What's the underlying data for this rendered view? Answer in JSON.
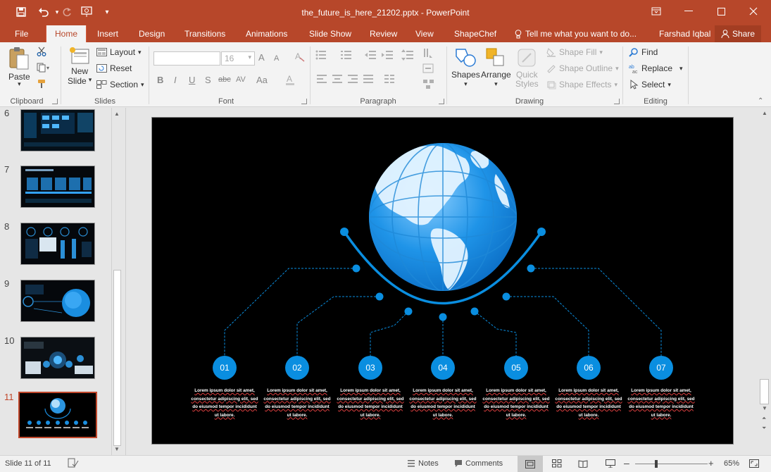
{
  "app": {
    "doc_title": "the_future_is_here_21202.pptx - PowerPoint",
    "user": "Farshad Iqbal",
    "share": "Share",
    "tell_me": "Tell me what you want to do..."
  },
  "tabs": [
    "File",
    "Home",
    "Insert",
    "Design",
    "Transitions",
    "Animations",
    "Slide Show",
    "Review",
    "View",
    "ShapeChef"
  ],
  "ribbon": {
    "clipboard": {
      "label": "Clipboard",
      "paste": "Paste"
    },
    "slides": {
      "label": "Slides",
      "new_slide_1": "New",
      "new_slide_2": "Slide",
      "layout": "Layout",
      "reset": "Reset",
      "section": "Section"
    },
    "font": {
      "label": "Font",
      "size": "16",
      "bold": "B",
      "italic": "I",
      "underline": "U",
      "shadow": "S",
      "strike": "abc",
      "spacing": "AV",
      "case": "Aa",
      "grow": "A",
      "shrink": "A"
    },
    "paragraph": {
      "label": "Paragraph"
    },
    "drawing": {
      "label": "Drawing",
      "shapes": "Shapes",
      "arrange": "Arrange",
      "quick_1": "Quick",
      "quick_2": "Styles",
      "shape_fill": "Shape Fill",
      "shape_outline": "Shape Outline",
      "shape_effects": "Shape Effects"
    },
    "editing": {
      "label": "Editing",
      "find": "Find",
      "replace": "Replace",
      "select": "Select"
    }
  },
  "thumbnails": [
    {
      "num": "6",
      "active": false
    },
    {
      "num": "7",
      "active": false
    },
    {
      "num": "8",
      "active": false
    },
    {
      "num": "9",
      "active": false
    },
    {
      "num": "10",
      "active": false
    },
    {
      "num": "11",
      "active": true
    }
  ],
  "slide": {
    "items": [
      {
        "num": "01",
        "text": "Lorem ipsum dolor sit amet, consectetur adipiscing elit, sed do eiusmod tempor incididunt ut labore."
      },
      {
        "num": "02",
        "text": "Lorem ipsum dolor sit amet, consectetur adipiscing elit, sed do eiusmod tempor incididunt ut labore."
      },
      {
        "num": "03",
        "text": "Lorem ipsum dolor sit amet, consectetur adipiscing elit, sed do eiusmod tempor incididunt ut labore."
      },
      {
        "num": "04",
        "text": "Lorem ipsum dolor sit amet, consectetur adipiscing elit, sed do eiusmod tempor incididunt ut labore."
      },
      {
        "num": "05",
        "text": "Lorem ipsum dolor sit amet, consectetur adipiscing elit, sed do eiusmod tempor incididunt ut labore."
      },
      {
        "num": "06",
        "text": "Lorem ipsum dolor sit amet, consectetur adipiscing elit, sed do eiusmod tempor incididunt ut labore."
      },
      {
        "num": "07",
        "text": "Lorem ipsum dolor sit amet, consectetur adipiscing elit, sed do eiusmod tempor incididunt ut labore."
      }
    ]
  },
  "status": {
    "slide_info": "Slide 11 of 11",
    "notes": "Notes",
    "comments": "Comments",
    "zoom": "65%",
    "zoom_level": 0.65
  },
  "colors": {
    "accent": "#b7472a",
    "slide_blue": "#0a8ee0",
    "slide_bg": "#000000"
  }
}
